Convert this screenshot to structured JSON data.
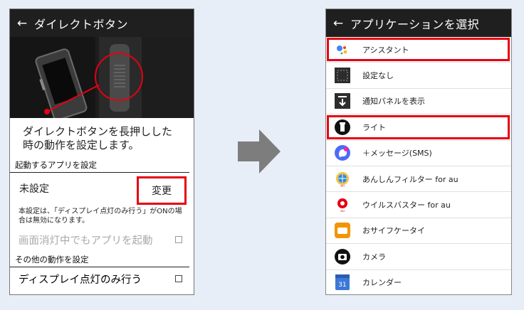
{
  "left": {
    "title": "ダイレクトボタン",
    "description_line1": "ダイレクトボタンを長押しした",
    "description_line2": "時の動作を設定します。",
    "section_app": "起動するアプリを設定",
    "current_value": "未設定",
    "change_label": "変更",
    "note": "本設定は、「ディスプレイ点灯のみ行う」がONの場合は無効になります。",
    "toggle_off_screen": "画面消灯中でもアプリを起動",
    "section_other": "その他の動作を設定",
    "toggle_display_only": "ディスプレイ点灯のみ行う"
  },
  "right": {
    "title": "アプリケーションを選択",
    "items": [
      {
        "label": "アシスタント",
        "highlighted": true
      },
      {
        "label": "設定なし",
        "highlighted": false
      },
      {
        "label": "通知パネルを表示",
        "highlighted": false
      },
      {
        "label": "ライト",
        "highlighted": true
      },
      {
        "label": "＋メッセージ(SMS)",
        "highlighted": false
      },
      {
        "label": "あんしんフィルター for au",
        "highlighted": false
      },
      {
        "label": "ウイルスバスター for au",
        "highlighted": false
      },
      {
        "label": "おサイフケータイ",
        "highlighted": false
      },
      {
        "label": "カメラ",
        "highlighted": false
      },
      {
        "label": "カレンダー",
        "highlighted": false
      }
    ],
    "calendar_day": "31"
  },
  "colors": {
    "accent": "#e60012",
    "appbar": "#1f1f1f",
    "background": "#e8eef7"
  }
}
